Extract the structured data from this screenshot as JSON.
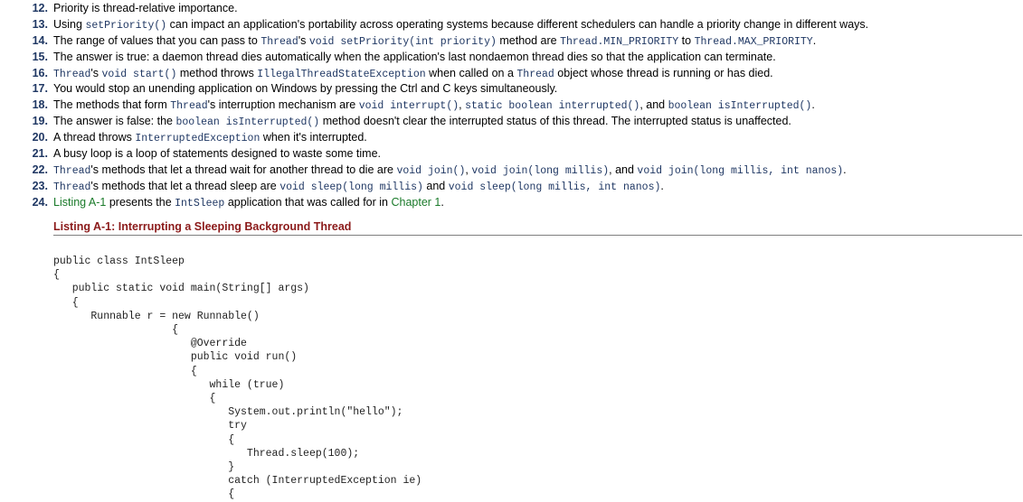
{
  "items": [
    {
      "num": "12.",
      "parts": [
        {
          "t": "Priority is thread-relative importance."
        }
      ]
    },
    {
      "num": "13.",
      "parts": [
        {
          "t": "Using "
        },
        {
          "t": "setPriority()",
          "s": "mono"
        },
        {
          "t": " can impact an application's portability across operating systems because different schedulers can handle a priority change in different ways."
        }
      ]
    },
    {
      "num": "14.",
      "parts": [
        {
          "t": "The range of values that you can pass to "
        },
        {
          "t": "Thread",
          "s": "mono"
        },
        {
          "t": "'s "
        },
        {
          "t": "void setPriority(int priority)",
          "s": "mono"
        },
        {
          "t": " method are "
        },
        {
          "t": "Thread.MIN_PRIORITY",
          "s": "mono"
        },
        {
          "t": " to "
        },
        {
          "t": "Thread.MAX_PRIORITY",
          "s": "mono"
        },
        {
          "t": "."
        }
      ]
    },
    {
      "num": "15.",
      "parts": [
        {
          "t": "The answer is true: a daemon thread dies automatically when the application's last nondaemon thread dies so that the application can terminate."
        }
      ]
    },
    {
      "num": "16.",
      "parts": [
        {
          "t": "Thread",
          "s": "mono"
        },
        {
          "t": "'s "
        },
        {
          "t": "void start()",
          "s": "mono"
        },
        {
          "t": " method throws "
        },
        {
          "t": "IllegalThreadStateException",
          "s": "mono"
        },
        {
          "t": " when called on a "
        },
        {
          "t": "Thread",
          "s": "mono"
        },
        {
          "t": " object whose thread is running or has died."
        }
      ]
    },
    {
      "num": "17.",
      "parts": [
        {
          "t": "You would stop an unending application on Windows by pressing the Ctrl and C keys simultaneously."
        }
      ]
    },
    {
      "num": "18.",
      "parts": [
        {
          "t": "The methods that form "
        },
        {
          "t": "Thread",
          "s": "mono"
        },
        {
          "t": "'s interruption mechanism are "
        },
        {
          "t": "void interrupt()",
          "s": "mono"
        },
        {
          "t": ", "
        },
        {
          "t": "static boolean interrupted()",
          "s": "mono"
        },
        {
          "t": ", and "
        },
        {
          "t": "boolean isInterrupted()",
          "s": "mono"
        },
        {
          "t": "."
        }
      ]
    },
    {
      "num": "19.",
      "parts": [
        {
          "t": "The answer is false: the "
        },
        {
          "t": "boolean isInterrupted()",
          "s": "mono"
        },
        {
          "t": " method doesn't clear the interrupted status of this thread. The interrupted status is unaffected."
        }
      ]
    },
    {
      "num": "20.",
      "parts": [
        {
          "t": "A thread throws "
        },
        {
          "t": "InterruptedException",
          "s": "mono"
        },
        {
          "t": " when it's interrupted."
        }
      ]
    },
    {
      "num": "21.",
      "parts": [
        {
          "t": "A busy loop is a loop of statements designed to waste some time."
        }
      ]
    },
    {
      "num": "22.",
      "parts": [
        {
          "t": "Thread",
          "s": "mono"
        },
        {
          "t": "'s methods that let a thread wait for another thread to die are "
        },
        {
          "t": "void join()",
          "s": "mono"
        },
        {
          "t": ", "
        },
        {
          "t": "void join(long millis)",
          "s": "mono"
        },
        {
          "t": ", and "
        },
        {
          "t": "void join(long millis, int nanos)",
          "s": "mono"
        },
        {
          "t": "."
        }
      ]
    },
    {
      "num": "23.",
      "parts": [
        {
          "t": "Thread",
          "s": "mono"
        },
        {
          "t": "'s methods that let a thread sleep are "
        },
        {
          "t": "void sleep(long millis)",
          "s": "mono"
        },
        {
          "t": " and "
        },
        {
          "t": "void sleep(long millis, int nanos)",
          "s": "mono"
        },
        {
          "t": "."
        }
      ]
    },
    {
      "num": "24.",
      "parts": [
        {
          "t": "Listing A-1",
          "s": "link"
        },
        {
          "t": " presents the "
        },
        {
          "t": "IntSleep",
          "s": "mono"
        },
        {
          "t": " application that was called for in "
        },
        {
          "t": "Chapter 1",
          "s": "link"
        },
        {
          "t": "."
        }
      ]
    }
  ],
  "listing": {
    "title": "Listing A-1: Interrupting a Sleeping Background Thread",
    "code": "public class IntSleep\n{\n   public static void main(String[] args)\n   {\n      Runnable r = new Runnable()\n                   {\n                      @Override\n                      public void run()\n                      {\n                         while (true)\n                         {\n                            System.out.println(\"hello\");\n                            try\n                            {\n                               Thread.sleep(100);\n                            }\n                            catch (InterruptedException ie)\n                            {"
  }
}
